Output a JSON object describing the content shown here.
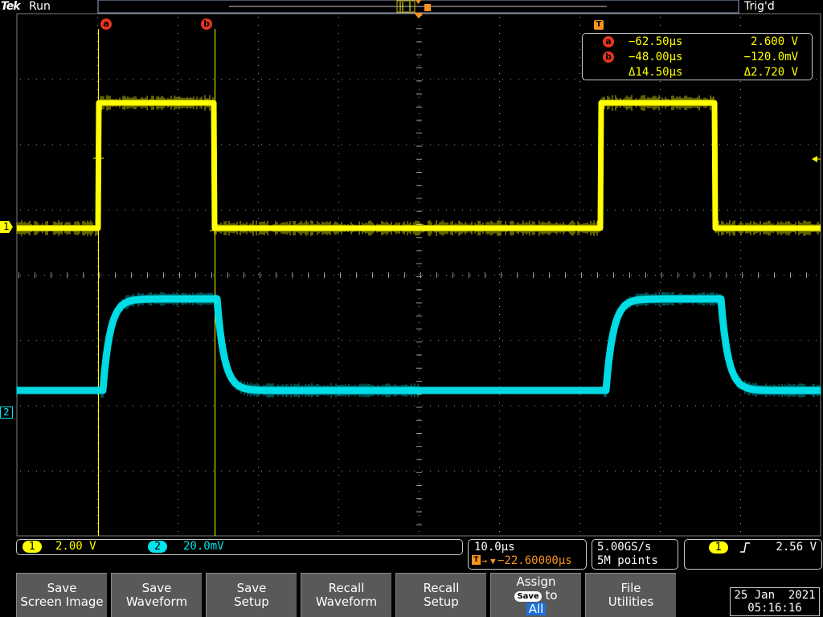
{
  "header": {
    "brand": "Tek",
    "acq_state": "Run",
    "trigger_state": "Trig'd"
  },
  "markers": {
    "cursor_a": "a",
    "cursor_b": "b",
    "trigger_marker": "T",
    "ch1_marker": "1",
    "ch2_marker": "2"
  },
  "cursor_readout": {
    "a_time": "−62.50µs",
    "a_value": "2.600 V",
    "b_time": "−48.00µs",
    "b_value": "−120.0mV",
    "delta_time": "Δ14.50µs",
    "delta_value": "Δ2.720 V"
  },
  "channels": [
    {
      "id": "1",
      "scale": "2.00 V",
      "color": "#ffff00"
    },
    {
      "id": "2",
      "scale": "20.0mV",
      "color": "#00e5ee"
    }
  ],
  "horizontal": {
    "time_per_div": "10.0µs",
    "trigger_position": "−22.60000µs"
  },
  "acquisition": {
    "sample_rate": "5.00GS/s",
    "record_length": "5M points"
  },
  "trigger": {
    "source": "1",
    "slope_icon": "rising-edge-icon",
    "level": "2.56 V"
  },
  "softkeys": [
    {
      "line1": "Save",
      "line2": "Screen Image"
    },
    {
      "line1": "Save",
      "line2": "Waveform"
    },
    {
      "line1": "Save",
      "line2": "Setup"
    },
    {
      "line1": "Recall",
      "line2": "Waveform"
    },
    {
      "line1": "Recall",
      "line2": "Setup"
    },
    {
      "line1": "Assign",
      "chip": "Save",
      "line2": "to",
      "line3": "All"
    },
    {
      "line1": "File",
      "line2": "Utilities"
    }
  ],
  "datetime": {
    "date": "25 Jan  2021",
    "time": "05:16:16"
  },
  "colors": {
    "ch1": "#ffff00",
    "ch2": "#00e5ee",
    "cursor_badge": "#e8361c",
    "trigger_marker": "#f7941d",
    "graticule": "#9a9a9a",
    "softkey_bg": "#595959"
  }
}
